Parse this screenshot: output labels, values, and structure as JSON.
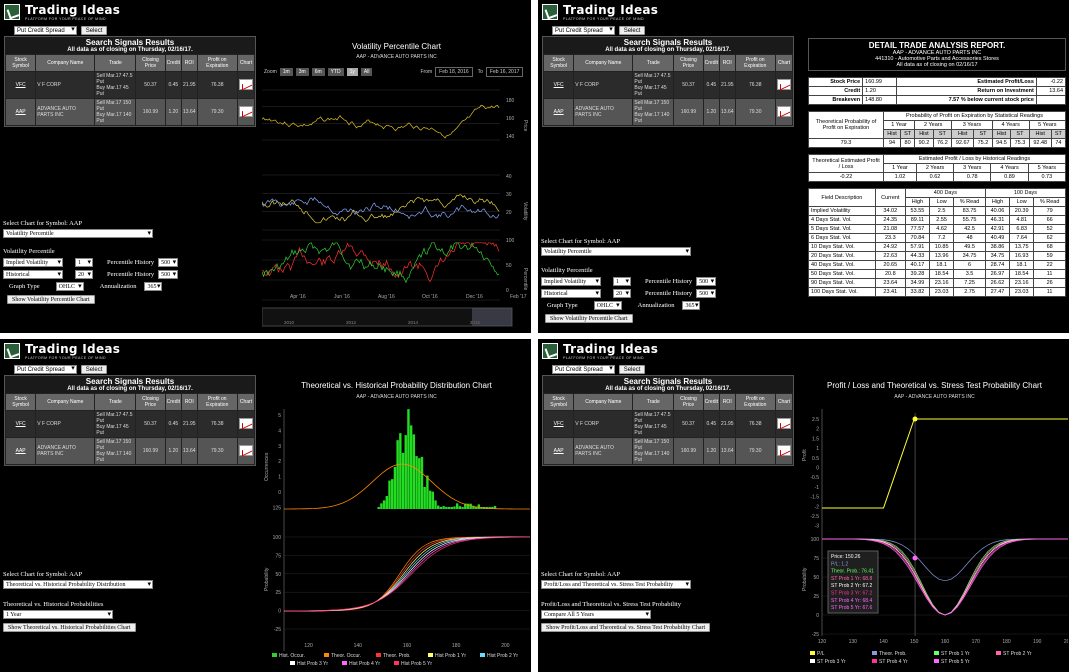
{
  "brand": {
    "name": "Trading Ideas",
    "tagline": "PLATFORM FOR YOUR PEACE OF MIND"
  },
  "strategy": "Put Credit Spread",
  "select_label": "Select",
  "signals": {
    "title": "Search Signals Results",
    "subtitle": "All data as of closing on Thursday, 02/16/17.",
    "columns": [
      "Stock Symbol",
      "Company Name",
      "Trade",
      "Closing Price",
      "Credit",
      "ROI",
      "Profit on Expiration",
      "Chart"
    ],
    "rows": [
      {
        "symbol": "VFC",
        "company": "V F CORP",
        "trade1": "Sell Mar.17 47.5 Put",
        "trade2": "Buy Mar.17 45 Put",
        "price": "50.37",
        "credit": "0.45",
        "roi": "21.95",
        "profit": "76.38"
      },
      {
        "symbol": "AAP",
        "company": "ADVANCE AUTO PARTS INC",
        "trade1": "Sell Mar.17 150 Put",
        "trade2": "Buy Mar.17 140 Put",
        "price": "160.99",
        "credit": "1.20",
        "roi": "13.64",
        "profit": "79.30"
      }
    ]
  },
  "select_chart_label": "Select Chart for Symbol:",
  "symbol": "AAP",
  "p1": {
    "chart_choice": "Volatility Percentile",
    "section": "Volatility Percentile",
    "iv_label": "Implied Volatility",
    "iv_val": "1",
    "hv_label": "Historical Volatility",
    "hv_val": "20",
    "ph1": "Percentile History",
    "ph1_val": "500",
    "ph2": "Percentile History",
    "ph2_val": "500",
    "gt": "Graph Type",
    "gt_val": "OHLC",
    "ann": "Annualization",
    "ann_val": "365",
    "show_btn": "Show Volatility Percentile Chart",
    "chart_title": "Volatility Percentile Chart",
    "chart_sub": "AAP - ADVANCE AUTO PARTS INC",
    "zoom": "Zoom",
    "zooms": [
      "1m",
      "3m",
      "6m",
      "YTD",
      "1y",
      "All"
    ],
    "from_label": "From",
    "from": "Feb 18, 2016",
    "to_label": "To",
    "to": "Feb 16, 2017",
    "x_ticks": [
      "Apr '16",
      "Jun '16",
      "Aug '16",
      "Oct '16",
      "Dec '16",
      "Feb '17"
    ],
    "nav_ticks": [
      "2010",
      "2012",
      "2014",
      "2016"
    ],
    "price_ticks": [
      "180",
      "160",
      "140"
    ],
    "vol_ticks": [
      "40",
      "30",
      "20"
    ],
    "pct_ticks": [
      "100",
      "50",
      "0"
    ],
    "ylabels": [
      "Price",
      "Volatility",
      "Percentile"
    ]
  },
  "p2": {
    "report_title": "DETAIL TRADE ANALYSIS REPORT.",
    "company": "AAP - ADVANCE AUTO PARTS INC",
    "industry": "441310 - Automotive Parts and Accessories Stores",
    "asof": "All data as of closing on 02/16/17",
    "summary": [
      [
        "Stock Price",
        "160.99",
        "Estimated Profit/Loss",
        "-0.22"
      ],
      [
        "Credit",
        "1.20",
        "Return on Investment",
        "13.64"
      ],
      [
        "Breakeven",
        "148.80",
        "7.57 % below current stock price",
        ""
      ]
    ],
    "prob_title": "Theoretical Probability of Profit on Expiration",
    "prob_hdr": "Probability of Profit on Expiration by Statistical Readings",
    "years": [
      "1 Year",
      "2 Years",
      "3 Years",
      "4 Years",
      "5 Years"
    ],
    "hs": [
      "Hist",
      "ST"
    ],
    "prob_val": "79.3",
    "prob_vals": [
      "94",
      "80",
      "90.2",
      "76.2",
      "92.67",
      "75.2",
      "94.5",
      "75.3",
      "92.48",
      "74"
    ],
    "est_title": "Theoretical Estimated Profit / Loss",
    "est_hdr": "Estimated Profit / Loss by Historical Readings",
    "est_val": "-0.22",
    "est_vals": [
      "1.02",
      "0.62",
      "0.78",
      "0.89",
      "0.73"
    ],
    "field_hdr": [
      "Field Description",
      "Current",
      "400 Days",
      "100 Days"
    ],
    "sub_hdr": [
      "High",
      "Low",
      "% Read",
      "High",
      "Low",
      "% Read"
    ],
    "fields": [
      [
        "Implied Volatility",
        "34.02",
        "53.55",
        "2.5",
        "83.75",
        "40.06",
        "20.39",
        "79"
      ],
      [
        "4 Days Stat. Vol.",
        "24.35",
        "89.11",
        "2.55",
        "55.75",
        "46.31",
        "4.81",
        "66"
      ],
      [
        "5 Days Stat. Vol.",
        "21.08",
        "77.57",
        "4.62",
        "42.5",
        "42.91",
        "6.83",
        "52"
      ],
      [
        "6 Days Stat. Vol.",
        "23.3",
        "70.84",
        "7.2",
        "48",
        "40.49",
        "7.64",
        "62"
      ],
      [
        "10 Days Stat. Vol.",
        "24.92",
        "57.91",
        "10.85",
        "49.5",
        "38.86",
        "13.75",
        "68"
      ],
      [
        "20 Days Stat. Vol.",
        "22.63",
        "44.33",
        "13.96",
        "34.75",
        "34.75",
        "16.93",
        "59"
      ],
      [
        "40 Days Stat. Vol.",
        "20.65",
        "40.17",
        "18.1",
        "6",
        "28.74",
        "18.1",
        "22"
      ],
      [
        "50 Days Stat. Vol.",
        "20.8",
        "39.28",
        "18.54",
        "3.5",
        "26.97",
        "18.54",
        "11"
      ],
      [
        "90 Days Stat. Vol.",
        "23.64",
        "34.99",
        "23.16",
        "7.25",
        "26.62",
        "23.16",
        "26"
      ],
      [
        "100 Days Stat. Vol.",
        "23.41",
        "33.82",
        "23.03",
        "2.75",
        "27.47",
        "23.03",
        "11"
      ]
    ]
  },
  "p3": {
    "chart_choice": "Theoretical vs. Historical Probability Distribution",
    "section": "Theoretical vs. Historical Probabilities",
    "period": "1 Year",
    "show_btn": "Show Theoretical vs. Historical Probabilities Chart",
    "chart_title": "Theoretical vs. Historical Probability Distribution Chart",
    "chart_sub": "AAP - ADVANCE AUTO PARTS INC",
    "yl1": "Occurrences",
    "yl2": "Probability",
    "ticks_top": [
      "5",
      "4",
      "3",
      "2",
      "1",
      "0",
      "125"
    ],
    "ticks_bot": [
      "100",
      "75",
      "50",
      "25",
      "0",
      "-25"
    ],
    "x_ticks": [
      "120",
      "140",
      "160",
      "180",
      "200"
    ],
    "legend": [
      "Hist. Occur.",
      "Theor. Occur.",
      "Theor. Prob.",
      "Hist Prob 1 Yr",
      "Hist Prob 2 Yr",
      "Hist Prob 3 Yr",
      "Hist Prob 4 Yr",
      "Hist Prob 5 Yr"
    ],
    "colors": [
      "#33cc33",
      "#ff8800",
      "#ff3333",
      "#ffff66",
      "#66ddff",
      "#ffffff",
      "#ff66ff",
      "#ff3366"
    ]
  },
  "p4": {
    "chart_choice": "Profit/Loss and Theoretical vs. Stress Test Probability",
    "section": "Profit/Loss and Theoretical vs. Stress Test Probability",
    "period": "Compare All 5 Years",
    "show_btn": "Show Profit/Loss and Theoretical vs. Stress Test Probability Chart",
    "chart_title": "Profit / Loss and Theoretical vs. Stress Test Probability Chart",
    "chart_sub": "AAP - ADVANCE AUTO PARTS INC",
    "yl1": "Profit",
    "yl2": "Probability",
    "ticks_top": [
      "2.5",
      "2",
      "1.5",
      "1",
      "0.5",
      "0",
      "-0.5",
      "-1",
      "-1.5",
      "-2",
      "-2.5",
      "-3"
    ],
    "ticks_bot": [
      "100",
      "75",
      "50",
      "25",
      "0",
      "-25"
    ],
    "x_ticks": [
      "120",
      "130",
      "140",
      "150",
      "160",
      "170",
      "180",
      "190",
      "200"
    ],
    "tooltip": [
      [
        "Price:",
        "150.26"
      ],
      [
        "P/L:",
        "1.2"
      ],
      [
        "Theor. Prob.:",
        "76.41"
      ],
      [
        "ST Prob 1 Yr:",
        "68.8"
      ],
      [
        "ST Prob 2 Yr:",
        "67.2"
      ],
      [
        "ST Prob 3 Yr:",
        "67.2"
      ],
      [
        "ST Prob 4 Yr:",
        "68.4"
      ],
      [
        "ST Prob 5 Yr:",
        "67.6"
      ]
    ],
    "legend": [
      "P/L",
      "Theor. Prob.",
      "ST Prob 1 Yr",
      "ST Prob 2 Yr",
      "ST Prob 3 Yr",
      "ST Prob 4 Yr",
      "ST Prob 5 Yr"
    ],
    "colors": [
      "#ffff33",
      "#8899dd",
      "#66ff66",
      "#ff66aa",
      "#ffffff",
      "#ff3399",
      "#ff66ff"
    ]
  }
}
